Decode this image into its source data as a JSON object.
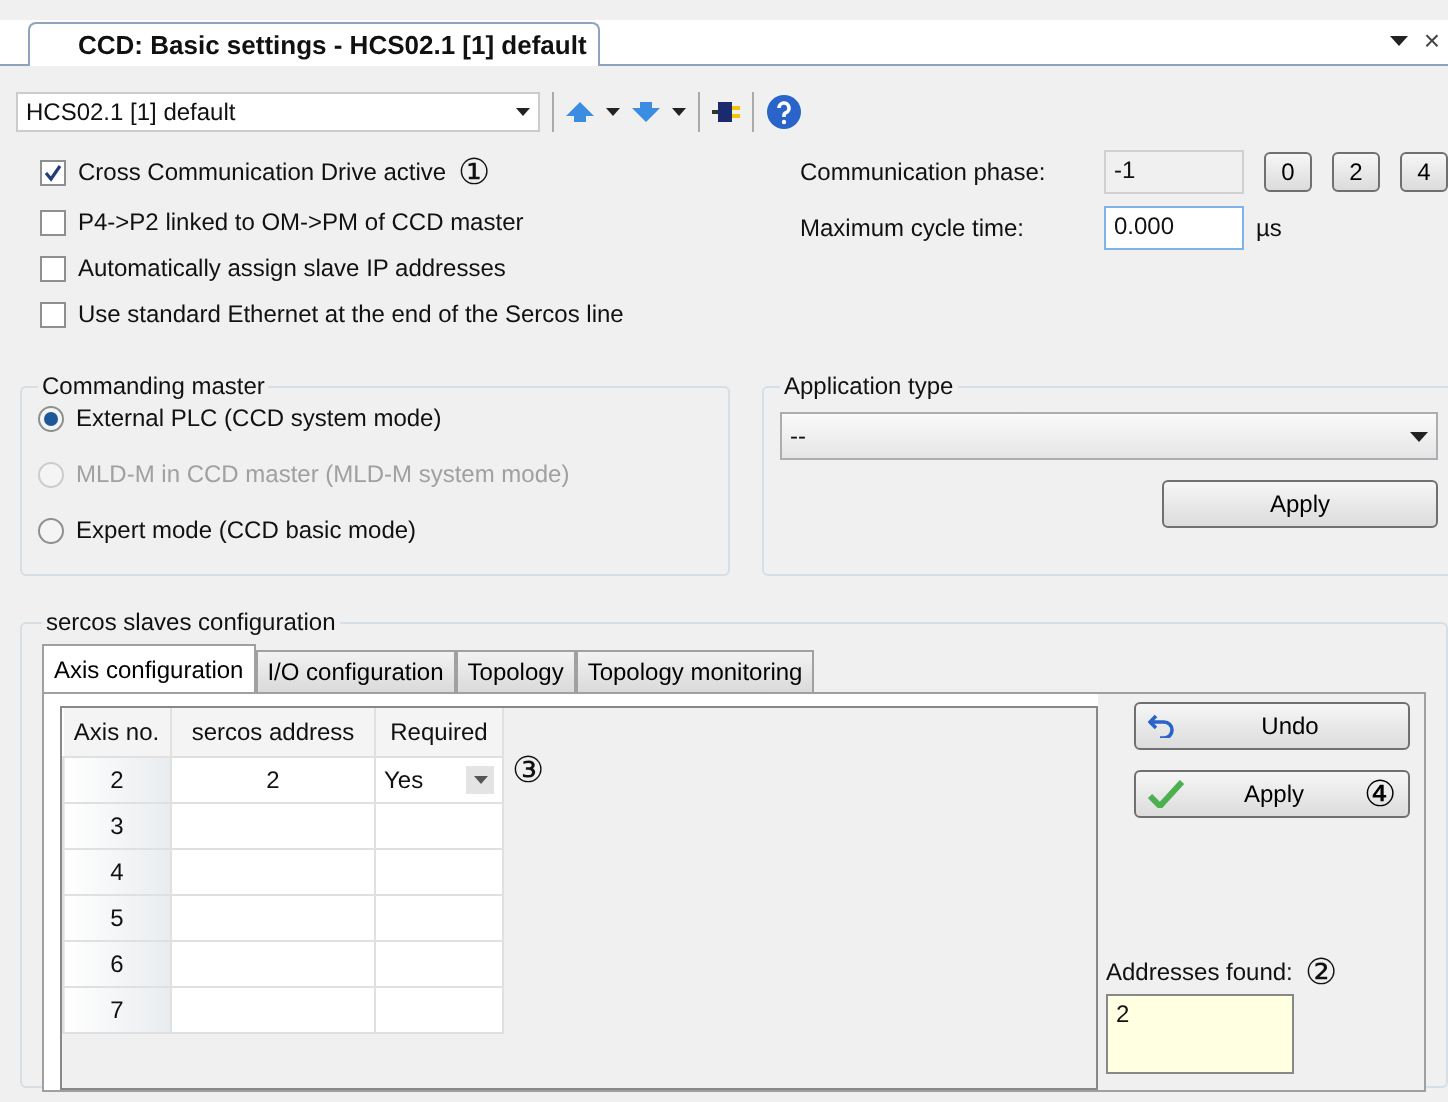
{
  "document_tab": {
    "title": "CCD: Basic settings - HCS02.1 [1] default",
    "close": "×"
  },
  "toolbar": {
    "device": "HCS02.1 [1] default"
  },
  "options": [
    {
      "label": "Cross Communication Drive active",
      "checked": true,
      "callout": "①"
    },
    {
      "label": "P4->P2 linked to OM->PM of CCD master",
      "checked": false
    },
    {
      "label": "Automatically assign slave IP addresses",
      "checked": false
    },
    {
      "label": "Use standard Ethernet at the end of the Sercos line",
      "checked": false
    }
  ],
  "communication_phase": {
    "label": "Communication phase:",
    "value": "-1",
    "buttons": [
      "0",
      "2",
      "4"
    ]
  },
  "maximum_cycle_time": {
    "label": "Maximum cycle time:",
    "value": "0.000",
    "unit": "µs"
  },
  "commanding_master": {
    "title": "Commanding master",
    "options": [
      {
        "label": "External PLC (CCD system mode)",
        "selected": true,
        "disabled": false
      },
      {
        "label": "MLD-M in CCD master (MLD-M system mode)",
        "selected": false,
        "disabled": true
      },
      {
        "label": "Expert mode (CCD basic mode)",
        "selected": false,
        "disabled": false
      }
    ]
  },
  "application_type": {
    "title": "Application type",
    "value": "--",
    "apply": "Apply"
  },
  "slaves": {
    "title": "sercos slaves configuration",
    "tabs": [
      {
        "label": "Axis configuration",
        "selected": true
      },
      {
        "label": "I/O configuration",
        "selected": false
      },
      {
        "label": "Topology",
        "selected": false
      },
      {
        "label": "Topology monitoring",
        "selected": false
      }
    ],
    "columns": [
      "Axis no.",
      "sercos address",
      "Required"
    ],
    "rows": [
      {
        "axis": "2",
        "address": "2",
        "required": "Yes",
        "callout": "③"
      },
      {
        "axis": "3",
        "address": "",
        "required": ""
      },
      {
        "axis": "4",
        "address": "",
        "required": ""
      },
      {
        "axis": "5",
        "address": "",
        "required": ""
      },
      {
        "axis": "6",
        "address": "",
        "required": ""
      },
      {
        "axis": "7",
        "address": "",
        "required": ""
      }
    ],
    "undo": "Undo",
    "apply": "Apply",
    "apply_callout": "④",
    "addresses_label": "Addresses found:",
    "addresses_callout": "②",
    "addresses": "2"
  }
}
